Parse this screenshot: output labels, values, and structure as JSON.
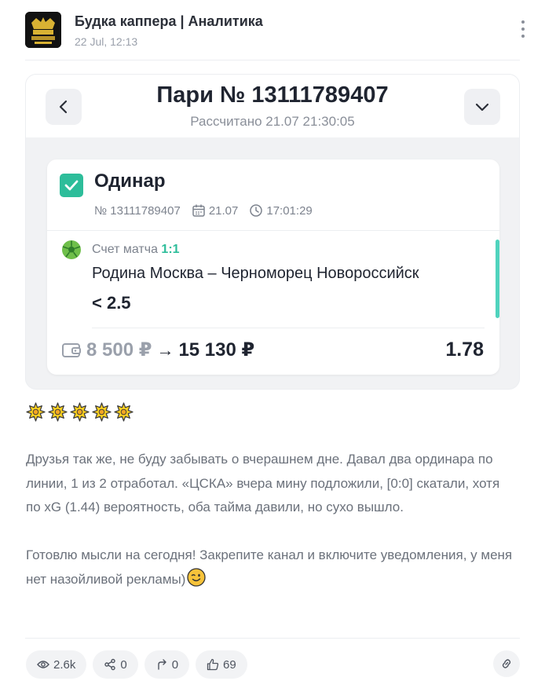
{
  "header": {
    "channel_name": "Будка каппера | Аналитика",
    "date": "22 Jul, 12:13",
    "avatar_text": "БУДКА КАППЕРА",
    "more_icon": "more-vertical-icon"
  },
  "bet": {
    "title": "Пари № 13111789407",
    "settled": "Рассчитано 21.07 21:30:05",
    "type": "Одинар",
    "number": "№ 13111789407",
    "date": "21.07",
    "time": "17:01:29",
    "score_label": "Счет матча",
    "score_value": "1:1",
    "match": "Родина Москва – Черноморец Новороссийск",
    "selection": "< 2.5",
    "stake": "8 500 ₽",
    "arrow": "→",
    "payout": "15 130 ₽",
    "odds": "1.78"
  },
  "post": {
    "stars_count": 5,
    "paragraph_1": "Друзья так же, не буду забывать о вчерашнем дне. Давал два ординара по линии, 1 из 2 отработал. «ЦСКА» вчера мину подложили, [0:0] скатали, хотя по xG (1.44) вероятность, оба тайма давили, но сухо вышло.",
    "paragraph_2": "Готовлю мысли на сегодня! Закрепите канал и включите уведомления, у меня нет назойливой рекламы)"
  },
  "footer": {
    "views": "2.6k",
    "shares": "0",
    "reposts": "0",
    "likes": "69"
  },
  "colors": {
    "accent": "#2dbd9a",
    "accent_bar": "#4fd3bd",
    "text": "#1f2430",
    "muted": "#8a8f99"
  }
}
